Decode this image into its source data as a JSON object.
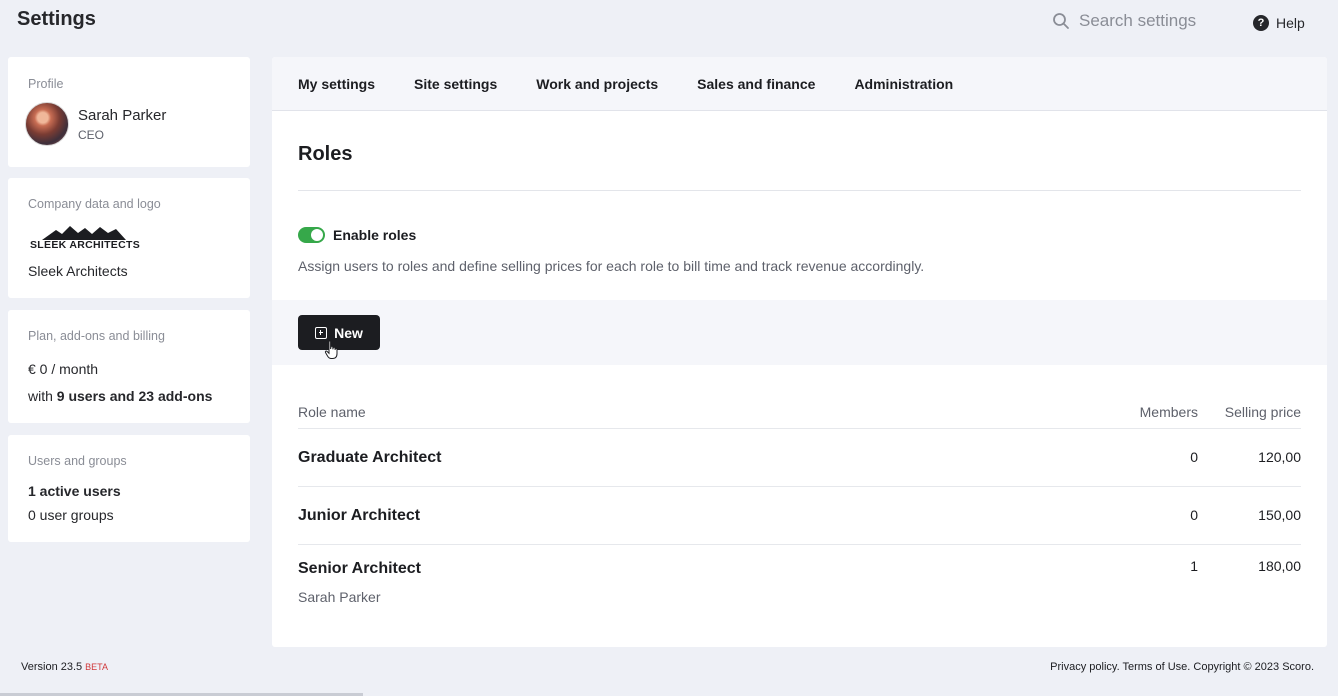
{
  "header": {
    "title": "Settings",
    "search_placeholder": "Search settings",
    "help_label": "Help"
  },
  "sidebar": {
    "profile": {
      "label": "Profile",
      "name": "Sarah Parker",
      "role": "CEO"
    },
    "company": {
      "label": "Company data and logo",
      "logo_text": "SLEEK ARCHITECTS",
      "name": "Sleek Architects"
    },
    "plan": {
      "label": "Plan, add-ons and billing",
      "price": "€ 0 / month",
      "with_prefix": "with",
      "users_addons": "9 users and 23 add-ons"
    },
    "users": {
      "label": "Users and groups",
      "active_users": "1 active users",
      "user_groups": "0 user groups"
    }
  },
  "tabs": [
    "My settings",
    "Site settings",
    "Work and projects",
    "Sales and finance",
    "Administration"
  ],
  "roles": {
    "title": "Roles",
    "toggle_label": "Enable roles",
    "toggle_on": true,
    "description": "Assign users to roles and define selling prices for each role to bill time and track revenue accordingly.",
    "new_button": "New",
    "columns": {
      "name": "Role name",
      "members": "Members",
      "price": "Selling price"
    },
    "rows": [
      {
        "name": "Graduate Architect",
        "members": "0",
        "price": "120,00",
        "sub": ""
      },
      {
        "name": "Junior Architect",
        "members": "0",
        "price": "150,00",
        "sub": ""
      },
      {
        "name": "Senior Architect",
        "members": "1",
        "price": "180,00",
        "sub": "Sarah Parker"
      }
    ]
  },
  "footer": {
    "version": "Version 23.5",
    "beta": "BETA",
    "legal": "Privacy policy. Terms of Use. Copyright © 2023 Scoro."
  },
  "colors": {
    "toggle_on": "#36a84a",
    "primary_button": "#1c1d21",
    "beta": "#d0383a"
  }
}
